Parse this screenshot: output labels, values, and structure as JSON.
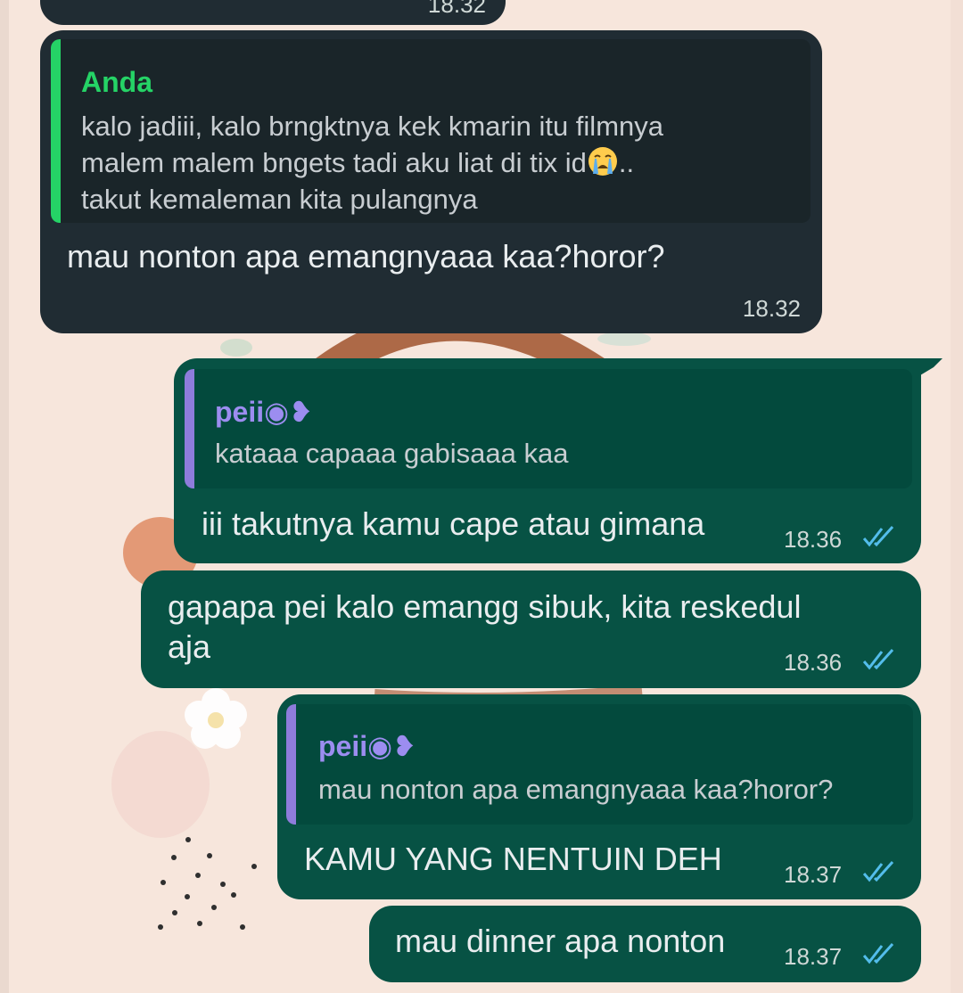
{
  "colors": {
    "wallpaper": "#f7e6dc",
    "incoming_bubble": "#202c33",
    "outgoing_bubble": "#075244",
    "quote_bar_incoming": "#25d366",
    "quote_bar_outgoing": "#8e7cdb",
    "quote_name_incoming": "#25d366",
    "quote_name_outgoing": "#9c8df0",
    "read_ticks": "#53bdeb"
  },
  "chat": {
    "top_partial_time": "18.32",
    "messages": [
      {
        "direction": "incoming",
        "quote": {
          "author": "Anda",
          "line1": "kalo jadiii, kalo brngktnya kek kmarin itu filmnya",
          "line2": "malem malem bngets tadi aku liat di tix id",
          "line2_suffix": "..",
          "line3": "takut kemaleman kita pulangnya",
          "emoji_icon": "crying-face-icon"
        },
        "text": "mau nonton apa emangnyaaa kaa?horor?",
        "time": "18.32"
      },
      {
        "direction": "outgoing",
        "quote": {
          "author": "peii◉❥",
          "line1": "kataaa capaaa gabisaaa kaa"
        },
        "text": "iii takutnya kamu cape atau gimana",
        "time": "18.36",
        "status": "double-check-icon"
      },
      {
        "direction": "outgoing",
        "line1": "gapapa pei kalo emangg sibuk, kita reskedul",
        "line2": "aja",
        "time": "18.36",
        "status": "double-check-icon"
      },
      {
        "direction": "outgoing",
        "quote": {
          "author": "peii◉❥",
          "line1": "mau nonton apa emangnyaaa kaa?horor?"
        },
        "text": "KAMU YANG NENTUIN DEH",
        "time": "18.37",
        "status": "double-check-icon"
      },
      {
        "direction": "outgoing",
        "text": "mau dinner apa nonton",
        "time": "18.37",
        "status": "double-check-icon"
      }
    ]
  }
}
